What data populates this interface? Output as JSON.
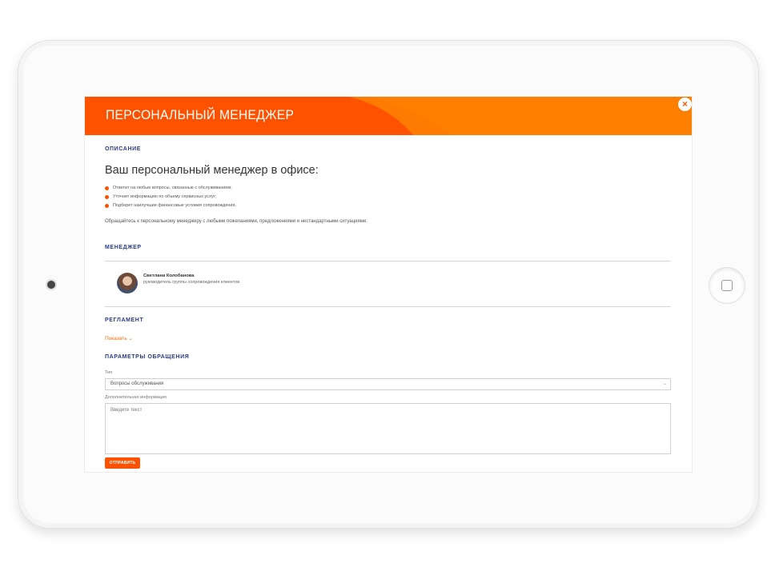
{
  "header": {
    "title": "ПЕРСОНАЛЬНЫЙ МЕНЕДЖЕР",
    "close_label": "×"
  },
  "description": {
    "section_label": "ОПИСАНИЕ",
    "heading": "Ваш персональный менеджер в офисе:",
    "bullets": [
      "Ответит на любые вопросы, связанные с обслуживанием;",
      "Уточнит информацию по объему сервисных услуг;",
      "Подберет наилучшие финансовые условия сопровождения."
    ],
    "text": "Обращайтесь к персональному менеджеру с любыми пожеланиями, предложениями и нестандартными ситуациями."
  },
  "manager": {
    "section_label": "МЕНЕДЖЕР",
    "name": "Светлана Колобанова",
    "role": "руководитель группы сопровождения клиентов"
  },
  "regulation": {
    "section_label": "РЕГЛАМЕНТ",
    "show_link": "Показать ⌄"
  },
  "params": {
    "section_label": "ПАРАМЕТРЫ ОБРАЩЕНИЯ",
    "type_label": "Тип",
    "type_value": "Вопросы обслуживания",
    "info_label": "Дополнительная информация",
    "info_placeholder": "Введите текст",
    "submit_label": "ОТПРАВИТЬ"
  },
  "icons": {
    "close": "close-icon",
    "chevron": "chevron-down-icon",
    "bullet": "bullet-dot-icon"
  },
  "colors": {
    "accent": "#fe5200",
    "accent_light": "#ff7a00",
    "section_label": "#2b3b8f"
  }
}
